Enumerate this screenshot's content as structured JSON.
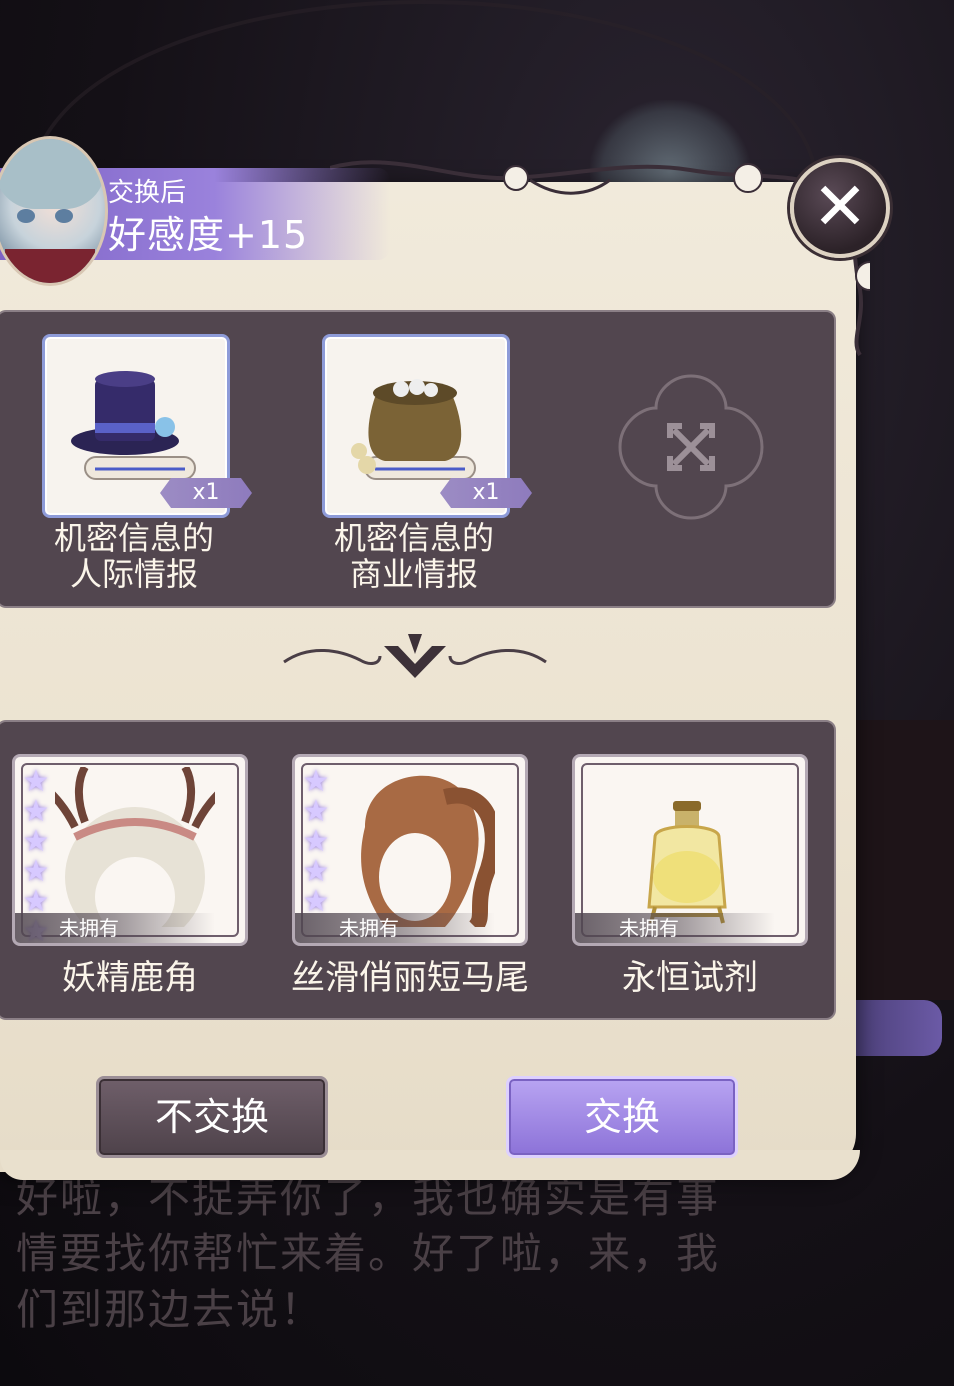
{
  "header": {
    "subtitle": "交换后",
    "affinity": "好感度+15"
  },
  "give_items": [
    {
      "name_line1": "机密信息的",
      "name_line2": "人际情报",
      "quantity": "x1",
      "icon": "top-hat-scroll-icon"
    },
    {
      "name_line1": "机密信息的",
      "name_line2": "商业情报",
      "quantity": "x1",
      "icon": "money-bag-scroll-icon"
    }
  ],
  "empty_slot_icon": "crossed-arrows-icon",
  "reward_items": [
    {
      "name": "妖精鹿角",
      "status": "未拥有",
      "stars": 6,
      "icon": "antler-headpiece-icon"
    },
    {
      "name": "丝滑俏丽短马尾",
      "status": "未拥有",
      "stars": 5,
      "icon": "ponytail-hair-icon"
    },
    {
      "name": "永恒试剂",
      "status": "未拥有",
      "stars": 0,
      "icon": "potion-bottle-icon"
    }
  ],
  "buttons": {
    "decline": "不交换",
    "confirm": "交换"
  },
  "dialogue": {
    "line1": "好啦，不捉弄你了，我也确实是有事",
    "line2": "情要找你帮忙来着。好了啦，来，我",
    "line3": "们到那边去说！"
  },
  "colors": {
    "accent_purple": "#9a82dc",
    "panel_parchment": "#ece3d1",
    "box_dark": "#52464f"
  }
}
